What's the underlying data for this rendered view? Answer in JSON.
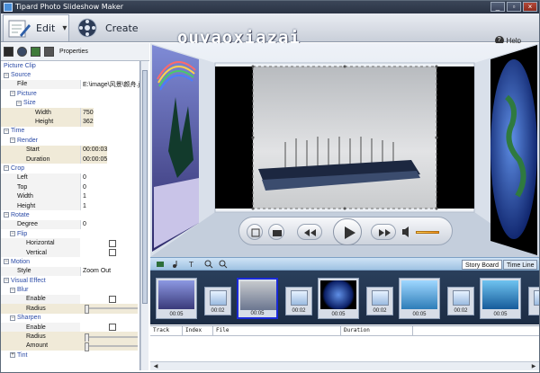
{
  "window": {
    "title": "Tipard Photo Slideshow Maker",
    "controls": [
      "_",
      "▫",
      "×"
    ]
  },
  "toolbar": {
    "edit_label": "Edit",
    "create_label": "Create",
    "help_label": "Help"
  },
  "watermark": "ouyaoxiazai",
  "subbar": {
    "properties_label": "Properties"
  },
  "properties": {
    "root": "Picture Clip",
    "source": "Source",
    "file_label": "File",
    "file_value": "E:\\image\\风景\\颜舟.jp",
    "picture": "Picture",
    "size": "Size",
    "width_label": "Width",
    "width_value": "750",
    "height_label": "Height",
    "height_value": "362",
    "time": "Time",
    "render": "Render",
    "start_label": "Start",
    "start_value": "00:00:03",
    "duration_label": "Duration",
    "duration_value": "00:00:05",
    "crop": "Crop",
    "left_label": "Left",
    "left_value": "0",
    "top_label": "Top",
    "top_value": "0",
    "crop_width_label": "Width",
    "crop_width_value": "1",
    "crop_height_label": "Height",
    "crop_height_value": "1",
    "rotate": "Rotate",
    "degree_label": "Degree",
    "degree_value": "0",
    "flip": "Flip",
    "horizontal_label": "Horizontal",
    "vertical_label": "Vertical",
    "motion": "Motion",
    "style_label": "Style",
    "style_value": "Zoom Out",
    "visual_effect": "Visual Effect",
    "blur": "Blur",
    "enable_label": "Enable",
    "radius_label": "Radius",
    "sharpen": "Sharpen",
    "enable2_label": "Enable",
    "radius2_label": "Radius",
    "amount_label": "Amount",
    "tint": "Tint"
  },
  "storyboard": {
    "tab_storyboard": "Story Board",
    "tab_timeline": "Time Line",
    "items": [
      {
        "kind": "photo",
        "label": "00:05"
      },
      {
        "kind": "transition",
        "label": "00:02"
      },
      {
        "kind": "photo",
        "label": "00:05",
        "selected": true
      },
      {
        "kind": "transition",
        "label": "00:02"
      },
      {
        "kind": "photo",
        "label": "00:05"
      },
      {
        "kind": "transition",
        "label": "00:02"
      },
      {
        "kind": "photo",
        "label": "00:05"
      },
      {
        "kind": "transition",
        "label": "00:02"
      },
      {
        "kind": "photo",
        "label": "00:05"
      }
    ]
  },
  "timeline": {
    "columns": [
      "Track",
      "Index",
      "File",
      "Duration"
    ]
  },
  "colors": {
    "accent": "#1a2ad8",
    "titlebar": "#2a3344",
    "strip": "#1c2c44"
  }
}
